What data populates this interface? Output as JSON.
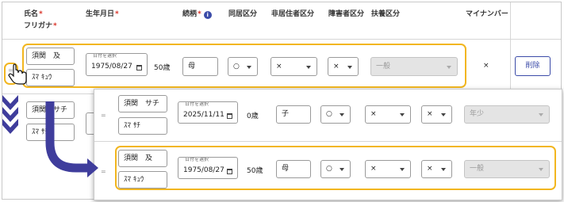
{
  "headers": {
    "name": "氏名",
    "furigana": "フリガナ",
    "birthdate": "生年月日",
    "relationship": "続柄",
    "cohabitation": "同居区分",
    "nonresident": "非居住者区分",
    "disability": "障害者区分",
    "dependent": "扶養区分",
    "mynumber": "マイナンバー",
    "required_mark": "*",
    "info_icon": "i"
  },
  "date_label": "日付を選択",
  "icons": {
    "drag_handle": "=",
    "calendar": "calendar-icon",
    "dropdown": "chevron-down-icon",
    "cursor": "hand-cursor-icon",
    "arrow": "curved-arrow-icon",
    "chevrons": "triple-chevron-down-icon"
  },
  "colors": {
    "highlight": "#f2b61f",
    "accent": "#3b4ba8",
    "arrow": "#3f3d9c",
    "required": "#d93025"
  },
  "row1": {
    "name": "須関　及",
    "kana": "ｽﾏ ｷｭｳ",
    "birthdate": "1975/08/27",
    "age": "50歳",
    "relationship": "母",
    "cohabitation": "○",
    "nonresident": "×",
    "disability": "×",
    "dependent": "一般",
    "mynumber": "×",
    "delete_label": "削除"
  },
  "row2_partial": {
    "name": "須関　サチ",
    "kana": "ｽﾏ ｻﾁ"
  },
  "overlay": {
    "rows": [
      {
        "name": "須関　サチ",
        "kana": "ｽﾏ ｻﾁ",
        "birthdate": "2025/11/11",
        "age": "0歳",
        "relationship": "子",
        "cohabitation": "○",
        "nonresident": "×",
        "disability": "×",
        "dependent": "年少"
      },
      {
        "name": "須関　及",
        "kana": "ｽﾏ ｷｭｳ",
        "birthdate": "1975/08/27",
        "age": "50歳",
        "relationship": "母",
        "cohabitation": "○",
        "nonresident": "×",
        "disability": "×",
        "dependent": "一般"
      }
    ]
  }
}
